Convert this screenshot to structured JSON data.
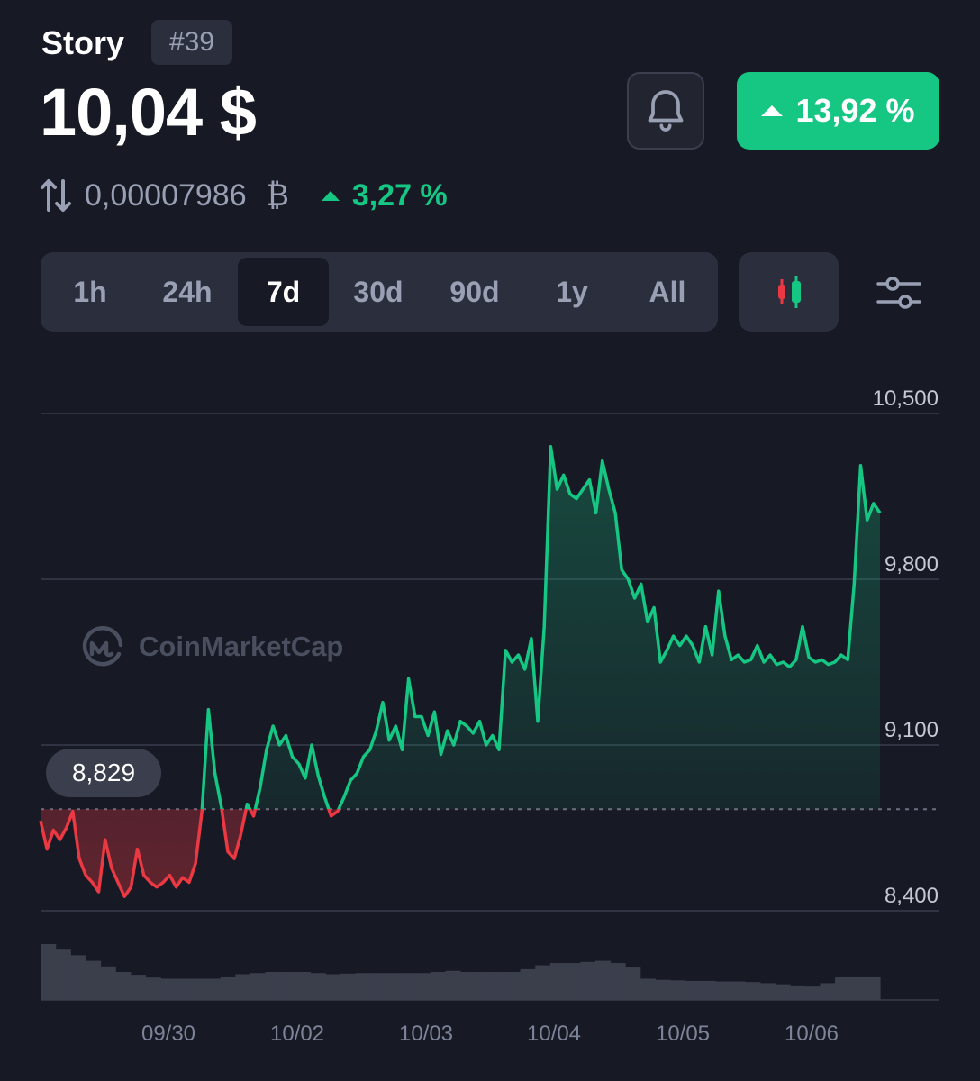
{
  "header": {
    "coin_name": "Story",
    "rank": "#39",
    "price": "10,04 $",
    "change_24h": "13,92 %",
    "change_color": "#16c784"
  },
  "btc": {
    "value": "0,00007986",
    "symbol": "₿",
    "change": "3,27 %"
  },
  "icons": {
    "bell": "bell-icon",
    "swap": "swap-arrows-icon",
    "candle": "candlestick-icon",
    "filter": "sliders-icon"
  },
  "tabs": [
    {
      "label": "1h",
      "active": false
    },
    {
      "label": "24h",
      "active": false
    },
    {
      "label": "7d",
      "active": true
    },
    {
      "label": "30d",
      "active": false
    },
    {
      "label": "90d",
      "active": false
    },
    {
      "label": "1y",
      "active": false
    },
    {
      "label": "All",
      "active": false
    }
  ],
  "watermark": "CoinMarketCap",
  "chart_data": {
    "type": "line",
    "baseline_value": 8.829,
    "baseline_label": "8,829",
    "y_tick_labels": [
      "10,500",
      "9,800",
      "9,100",
      "8,400"
    ],
    "y_ticks": [
      10.5,
      9.8,
      9.1,
      8.4
    ],
    "ylim": [
      8.4,
      10.5
    ],
    "x_tick_labels": [
      "09/30",
      "10/02",
      "10/03",
      "10/04",
      "10/05",
      "10/06"
    ],
    "up_color": "#16c784",
    "down_color": "#ea3943",
    "grid": true,
    "series": [
      {
        "values": [
          8.78,
          8.66,
          8.74,
          8.7,
          8.75,
          8.82,
          8.62,
          8.55,
          8.52,
          8.48,
          8.7,
          8.58,
          8.52,
          8.46,
          8.5,
          8.66,
          8.55,
          8.52,
          8.5,
          8.52,
          8.55,
          8.5,
          8.54,
          8.52,
          8.6,
          8.82,
          9.25,
          8.98,
          8.84,
          8.65,
          8.62,
          8.72,
          8.85,
          8.8,
          8.92,
          9.08,
          9.18,
          9.1,
          9.14,
          9.05,
          9.02,
          8.96,
          9.1,
          8.97,
          8.88,
          8.8,
          8.82,
          8.88,
          8.95,
          8.98,
          9.05,
          9.08,
          9.16,
          9.28,
          9.12,
          9.18,
          9.08,
          9.38,
          9.22,
          9.22,
          9.14,
          9.24,
          9.06,
          9.16,
          9.1,
          9.2,
          9.18,
          9.15,
          9.2,
          9.1,
          9.14,
          9.08,
          9.5,
          9.45,
          9.48,
          9.42,
          9.55,
          9.2,
          9.6,
          10.36,
          10.18,
          10.24,
          10.16,
          10.14,
          10.18,
          10.22,
          10.08,
          10.3,
          10.18,
          10.08,
          9.84,
          9.8,
          9.72,
          9.78,
          9.62,
          9.68,
          9.45,
          9.5,
          9.56,
          9.52,
          9.56,
          9.52,
          9.45,
          9.6,
          9.48,
          9.75,
          9.56,
          9.46,
          9.48,
          9.45,
          9.46,
          9.52,
          9.45,
          9.48,
          9.44,
          9.45,
          9.43,
          9.46,
          9.6,
          9.47,
          9.45,
          9.46,
          9.44,
          9.45,
          9.48,
          9.46,
          9.78,
          10.28,
          10.05,
          10.12,
          10.08
        ]
      }
    ],
    "volume": {
      "relative_values": [
        1.0,
        0.9,
        0.8,
        0.7,
        0.6,
        0.5,
        0.45,
        0.4,
        0.38,
        0.38,
        0.38,
        0.38,
        0.42,
        0.46,
        0.48,
        0.5,
        0.5,
        0.5,
        0.48,
        0.46,
        0.47,
        0.48,
        0.48,
        0.48,
        0.48,
        0.48,
        0.5,
        0.52,
        0.5,
        0.5,
        0.5,
        0.5,
        0.55,
        0.62,
        0.66,
        0.66,
        0.68,
        0.7,
        0.66,
        0.58,
        0.38,
        0.36,
        0.35,
        0.34,
        0.34,
        0.33,
        0.33,
        0.32,
        0.3,
        0.28,
        0.26,
        0.24,
        0.3,
        0.42,
        0.42,
        0.42
      ]
    }
  }
}
